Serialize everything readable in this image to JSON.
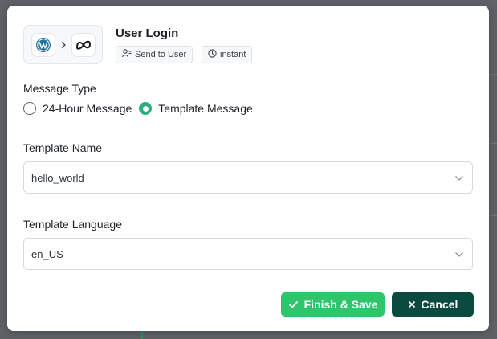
{
  "modal": {
    "title": "User Login",
    "source_app_icon": "wordpress-icon",
    "target_app_icon": "meta-icon",
    "chips": {
      "action": "Send to User",
      "action_icon": "user-list-icon",
      "trigger": "instant",
      "trigger_icon": "clock-icon"
    }
  },
  "message_type": {
    "label": "Message Type",
    "options": [
      {
        "label": "24-Hour Message",
        "selected": false
      },
      {
        "label": "Template Message",
        "selected": true
      }
    ]
  },
  "template_name": {
    "label": "Template Name",
    "value": "hello_world"
  },
  "template_language": {
    "label": "Template Language",
    "value": "en_US"
  },
  "buttons": {
    "save": "Finish & Save",
    "cancel": "Cancel"
  },
  "colors": {
    "accent_green": "#2fc56a",
    "radio_green": "#28b07a",
    "cancel_dark": "#0b4a3e"
  }
}
